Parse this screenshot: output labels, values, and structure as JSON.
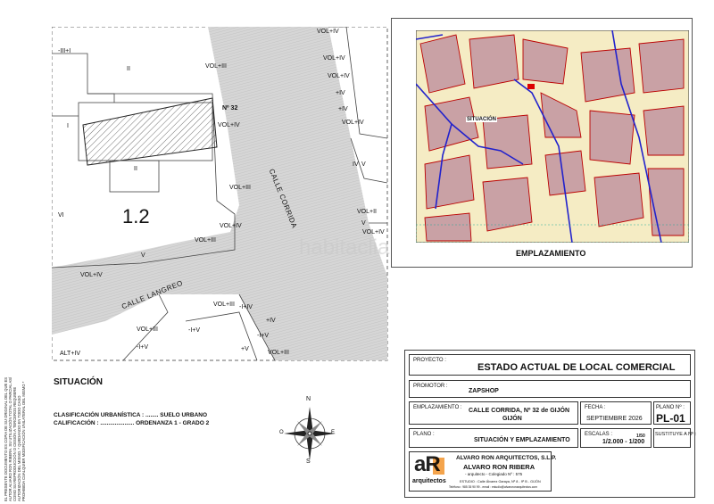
{
  "site_plan": {
    "street_corrida": "CALLE CORRIDA",
    "street_langreo": "CALLE LANGREO",
    "number": "Nº 32",
    "zone": "1.2",
    "labels": [
      "-III+I",
      "II",
      "VOL+III",
      "VOL+IV",
      "VOL+IV",
      "VOL+IV",
      "I",
      "II",
      "VOL+III",
      "IV",
      "V",
      "VI",
      "VOL+II",
      "VOL+IV",
      "V",
      "VOL+IV",
      "VOL+III",
      "-I+IV",
      "VOL+III",
      "-I+V",
      "-I+V",
      "-I+V",
      "VOL+III",
      "ALT+IV",
      "VOL+IV",
      "V",
      "VOL+IV",
      "+IV",
      "+IV",
      "+V",
      "+IV",
      "VOL+IV",
      "VOL+III"
    ]
  },
  "emplazamiento_caption": "EMPLAZAMIENTO",
  "map_label": "SITUACIÓN",
  "watermark": "habitaclia",
  "situacion": {
    "title": "SITUACIÓN",
    "clasificacion": "CLASIFICACIÓN URBANÍSTICA : ........ SUELO URBANO",
    "calificacion": "CALIFICACIÓN : ..................... ORDENANZA 1 - GRADO 2"
  },
  "compass": {
    "n": "N",
    "s": "S",
    "e": "E",
    "w": "O"
  },
  "side_note": "EL PRESENTE DOCUMENTO ES COPIA DE SU ORIGINAL DEL QUE ES AUTOR ALVARO RON RIBERA. SU UTILIZACIÓN TOTAL O PARCIAL ASÍ COMO SU REPRODUCCIÓN O CESIÓN A TERCEROS REQUIERE AUTORIZACIÓN DEL MISMO. * QUEDANDO EN TODO CASO PROHIBIDA CUALQUIER MODIFICACIÓN UNILATERAL DEL MISMO *",
  "cajetin": {
    "proyecto_label": "PROYECTO :",
    "proyecto": "ESTADO ACTUAL DE LOCAL COMERCIAL",
    "promotor_label": "PROMOTOR :",
    "promotor": "ZAPSHOP",
    "emplazamiento_label": "EMPLAZAMIENTO :",
    "emplazamiento_1": "CALLE CORRIDA, Nº 32 de GIJÓN",
    "emplazamiento_2": "GIJÓN",
    "fecha_label": "FECHA :",
    "fecha": "SEPTIEMBRE 2026",
    "plano_n_label": "PLANO Nº :",
    "plano_n": "PL-01",
    "plano_label": "PLANO :",
    "plano": "SITUACIÓN Y EMPLAZAMIENTO",
    "escalas_label": "ESCALAS :",
    "escalas": "1/2.000 - 1/200",
    "escala_extra": "1/50",
    "sustituye_label": "SUSTITUYE A Nº :",
    "logo": "aR",
    "logo_sub": "arquitectos",
    "firm": "ALVARO RON ARQUITECTOS, S.L.P.",
    "architect": "ALVARO RON RIBERA",
    "colegiado": "- arquitecto - Colegiado Nº : 575",
    "estudio": "ESTUDIO : Calle Álvarez Garaya, Nº 8 - 9º B - GIJÓN",
    "contacto": "Teléfono : 985 35 90 99 - email : estudio@alvaroronarquitectos.com"
  },
  "colors": {
    "accent": "#d00",
    "plan_fill": "#cfcfcf",
    "map_bg": "#f5ecc4",
    "block": "#c9a1a5",
    "blue_line": "#2222cc",
    "logo_orange": "#f07d00"
  }
}
